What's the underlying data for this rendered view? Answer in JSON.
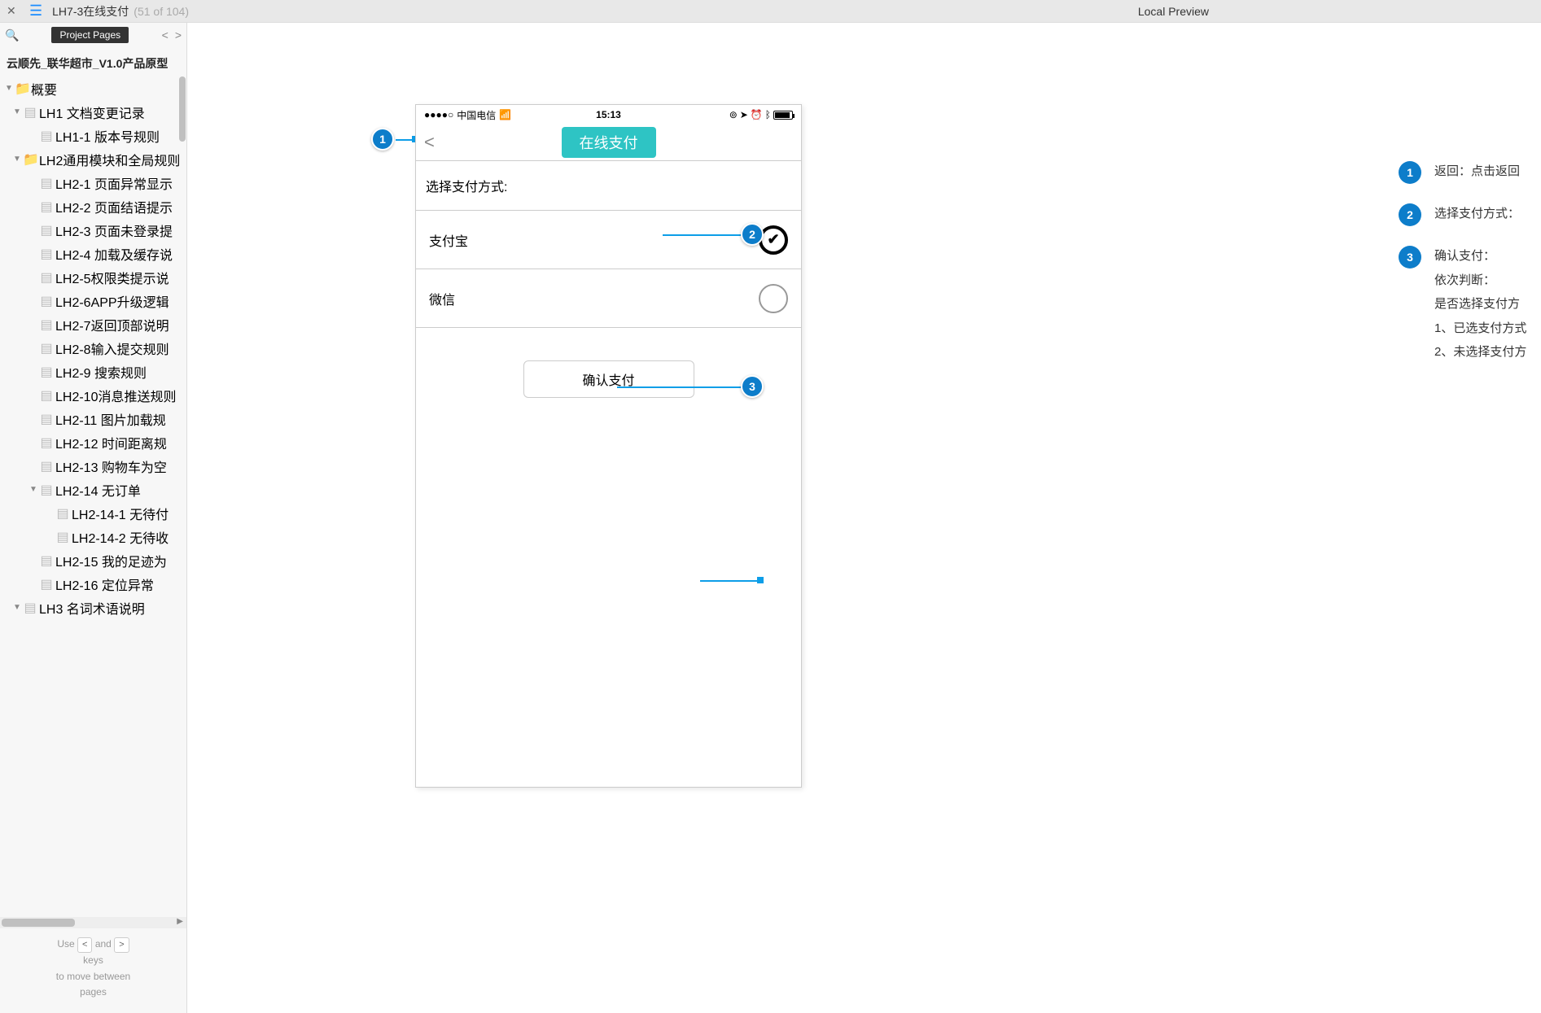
{
  "header": {
    "page_title": "LH7-3在线支付",
    "page_position": "(51 of 104)",
    "local_preview": "Local Preview"
  },
  "sidebar": {
    "project_pages_label": "Project Pages",
    "project_name": "云顺先_联华超市_V1.0产品原型",
    "help_line1_a": "Use",
    "help_line1_b": "and",
    "help_line2": "keys",
    "help_line3": "to move between",
    "help_line4": "pages",
    "tree": [
      {
        "caret": "▼",
        "ind": 0,
        "type": "folder",
        "label": "概要"
      },
      {
        "caret": "▼",
        "ind": 1,
        "type": "page",
        "label": "LH1 文档变更记录"
      },
      {
        "caret": "",
        "ind": 2,
        "type": "page",
        "label": "LH1-1 版本号规则"
      },
      {
        "caret": "▼",
        "ind": 1,
        "type": "folder",
        "label": "LH2通用模块和全局规则"
      },
      {
        "caret": "",
        "ind": 2,
        "type": "page",
        "label": "LH2-1 页面异常显示"
      },
      {
        "caret": "",
        "ind": 2,
        "type": "page",
        "label": "LH2-2 页面结语提示"
      },
      {
        "caret": "",
        "ind": 2,
        "type": "page",
        "label": "LH2-3 页面未登录提"
      },
      {
        "caret": "",
        "ind": 2,
        "type": "page",
        "label": "LH2-4 加载及缓存说"
      },
      {
        "caret": "",
        "ind": 2,
        "type": "page",
        "label": "LH2-5权限类提示说"
      },
      {
        "caret": "",
        "ind": 2,
        "type": "page",
        "label": "LH2-6APP升级逻辑"
      },
      {
        "caret": "",
        "ind": 2,
        "type": "page",
        "label": "LH2-7返回顶部说明"
      },
      {
        "caret": "",
        "ind": 2,
        "type": "page",
        "label": "LH2-8输入提交规则"
      },
      {
        "caret": "",
        "ind": 2,
        "type": "page",
        "label": "LH2-9 搜索规则"
      },
      {
        "caret": "",
        "ind": 2,
        "type": "page",
        "label": "LH2-10消息推送规则"
      },
      {
        "caret": "",
        "ind": 2,
        "type": "page",
        "label": "LH2-11 图片加载规"
      },
      {
        "caret": "",
        "ind": 2,
        "type": "page",
        "label": "LH2-12 时间距离规"
      },
      {
        "caret": "",
        "ind": 2,
        "type": "page",
        "label": "LH2-13 购物车为空"
      },
      {
        "caret": "▼",
        "ind": 2,
        "type": "page",
        "label": "LH2-14 无订单"
      },
      {
        "caret": "",
        "ind": 3,
        "type": "page",
        "label": "LH2-14-1 无待付"
      },
      {
        "caret": "",
        "ind": 3,
        "type": "page",
        "label": "LH2-14-2 无待收"
      },
      {
        "caret": "",
        "ind": 2,
        "type": "page",
        "label": "LH2-15 我的足迹为"
      },
      {
        "caret": "",
        "ind": 2,
        "type": "page",
        "label": "LH2-16 定位异常"
      },
      {
        "caret": "▼",
        "ind": 1,
        "type": "page",
        "label": "LH3 名词术语说明"
      }
    ]
  },
  "mockup": {
    "carrier": "中国电信",
    "time": "15:13",
    "nav_title": "在线支付",
    "section_label": "选择支付方式:",
    "options": [
      {
        "label": "支付宝",
        "checked": true
      },
      {
        "label": "微信",
        "checked": false
      }
    ],
    "confirm_label": "确认支付"
  },
  "annotations": {
    "items": [
      {
        "num": "1",
        "text": "返回：点击返回"
      },
      {
        "num": "2",
        "text": "选择支付方式："
      },
      {
        "num": "3",
        "lines": [
          "确认支付：",
          "依次判断：",
          "是否选择支付方",
          "1、已选支付方式",
          "2、未选择支付方"
        ]
      }
    ]
  },
  "markers": {
    "m1": "1",
    "m2": "2",
    "m3": "3"
  }
}
